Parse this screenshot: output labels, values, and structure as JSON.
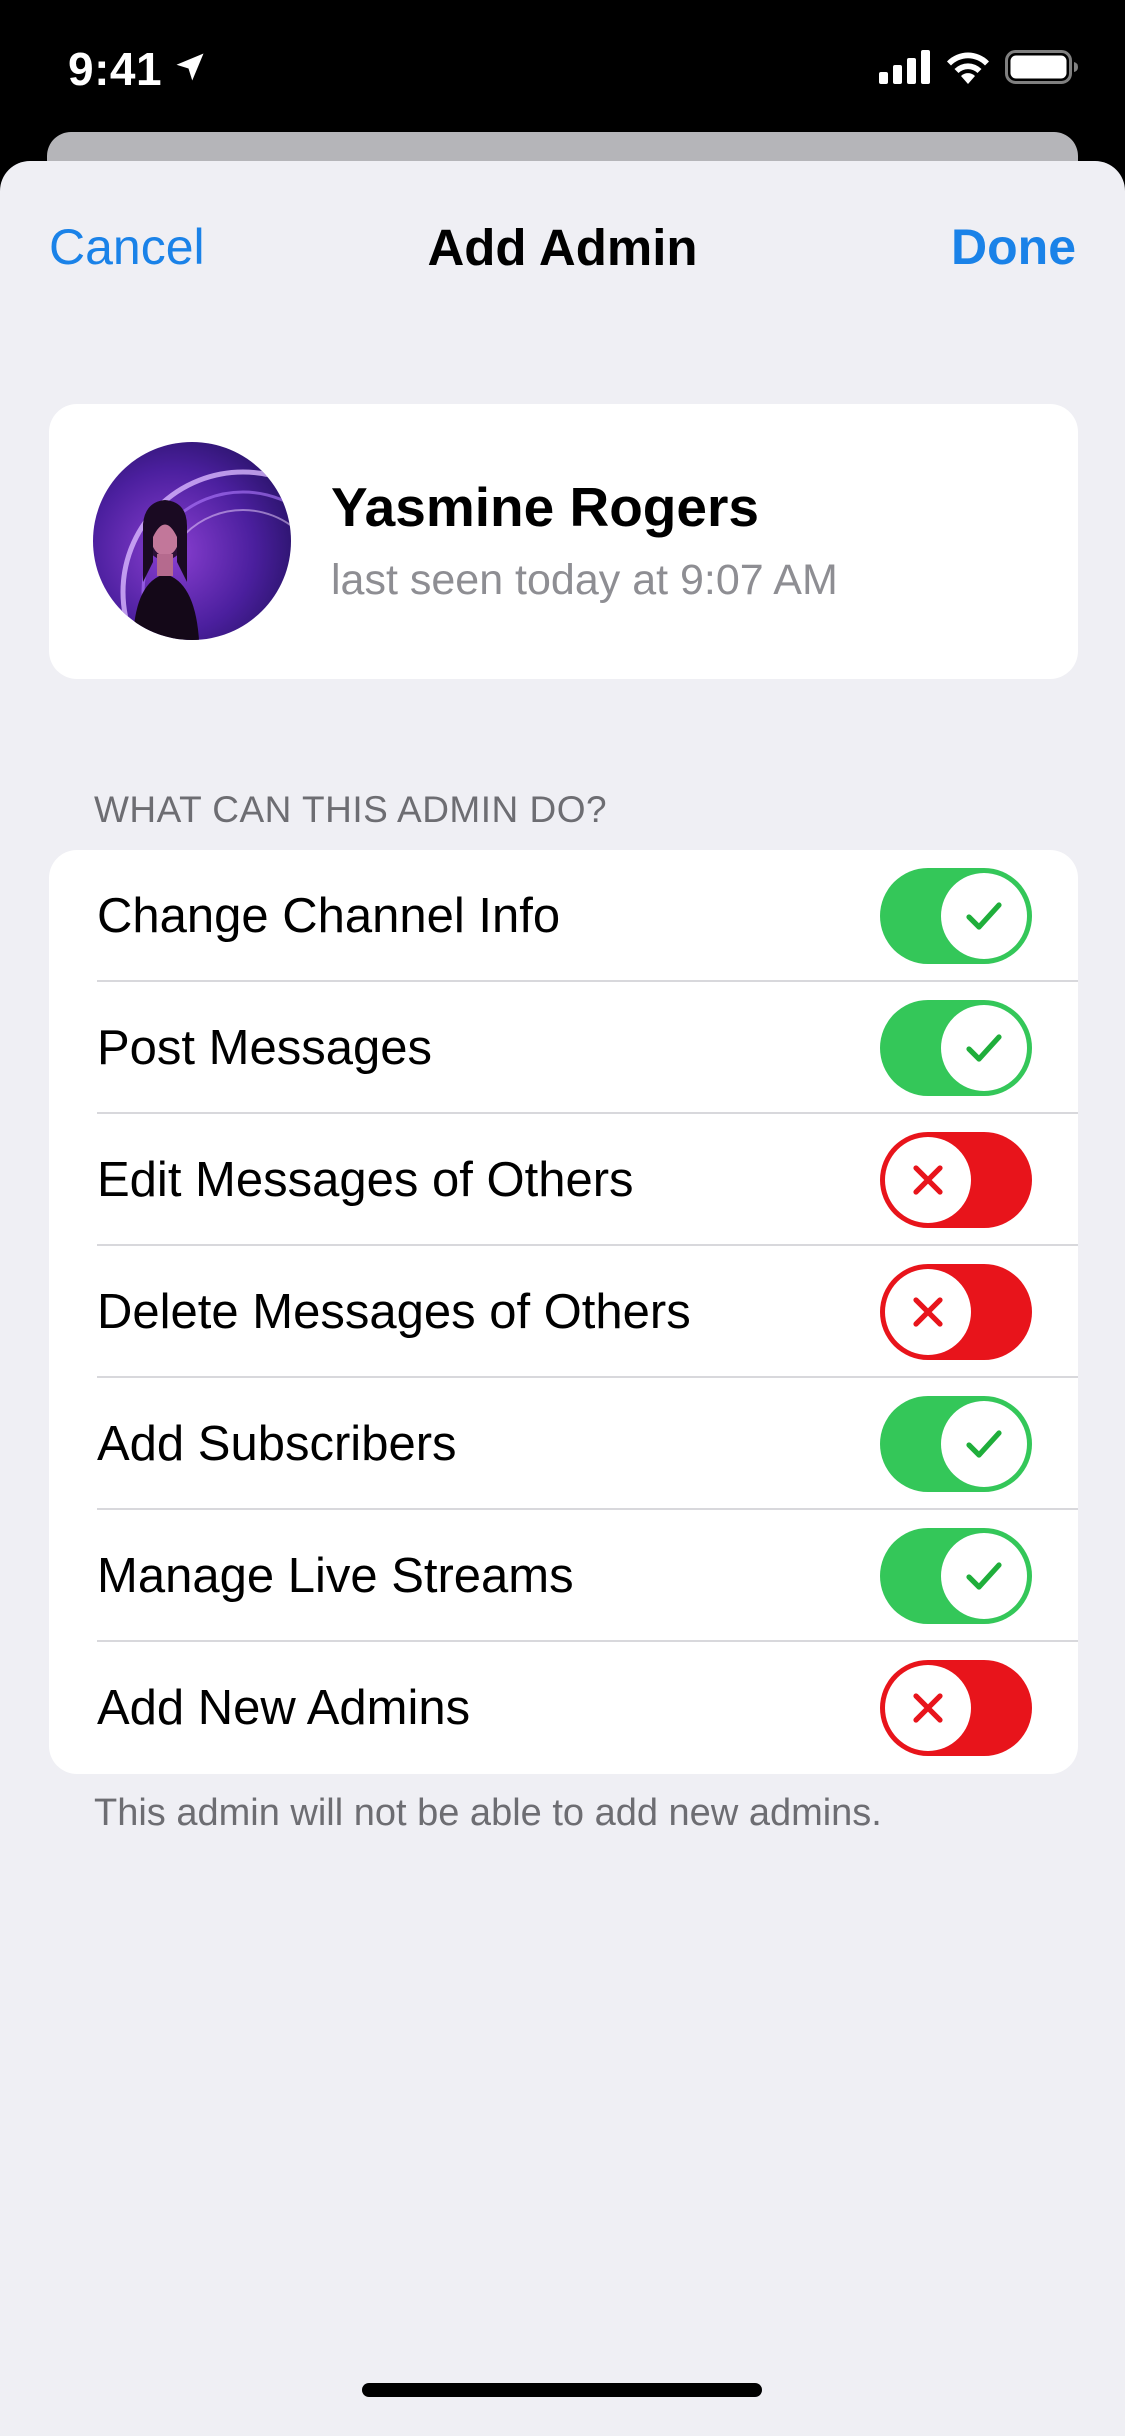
{
  "status_bar": {
    "time": "9:41",
    "icons": [
      "location-arrow-icon",
      "cellular-signal-icon",
      "wifi-icon",
      "battery-icon"
    ]
  },
  "nav": {
    "cancel": "Cancel",
    "title": "Add Admin",
    "done": "Done",
    "accent_color": "#1a82e8"
  },
  "profile": {
    "name": "Yasmine Rogers",
    "status": "last seen today at 9:07 AM"
  },
  "permissions": {
    "header": "WHAT CAN THIS ADMIN DO?",
    "items": [
      {
        "label": "Change Channel Info",
        "enabled": true
      },
      {
        "label": "Post Messages",
        "enabled": true
      },
      {
        "label": "Edit Messages of Others",
        "enabled": false
      },
      {
        "label": "Delete Messages of Others",
        "enabled": false
      },
      {
        "label": "Add Subscribers",
        "enabled": true
      },
      {
        "label": "Manage Live Streams",
        "enabled": true
      },
      {
        "label": "Add New Admins",
        "enabled": false
      }
    ],
    "footer": "This admin will not be able to add new admins.",
    "on_color": "#34c759",
    "off_color": "#e8141b"
  }
}
